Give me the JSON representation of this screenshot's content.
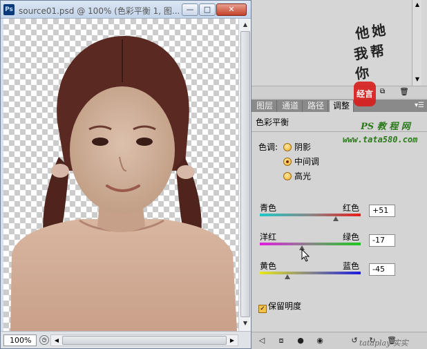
{
  "document": {
    "title": "source01.psd @ 100% (色彩平衡 1, 图...",
    "app_icon": "Ps",
    "zoom": "100%",
    "controls": {
      "minimize": "—",
      "maximize": "□",
      "close": "✕"
    }
  },
  "panel_tabs": [
    {
      "label": "图层",
      "active": false
    },
    {
      "label": "通道",
      "active": false
    },
    {
      "label": "路径",
      "active": false
    },
    {
      "label": "调整",
      "active": true
    }
  ],
  "adjustments": {
    "title": "色彩平衡",
    "tone_label": "色调:",
    "tones": [
      {
        "label": "阴影",
        "checked": false
      },
      {
        "label": "中间调",
        "checked": true
      },
      {
        "label": "高光",
        "checked": false
      }
    ],
    "sliders": [
      {
        "left": "青色",
        "right": "红色",
        "value": "+51",
        "level": 51,
        "colors": [
          "#1ec8c8",
          "#e81c1c"
        ]
      },
      {
        "left": "洋红",
        "right": "绿色",
        "value": "-17",
        "level": -17,
        "colors": [
          "#e01ce0",
          "#1cc81c"
        ]
      },
      {
        "left": "黄色",
        "right": "蓝色",
        "value": "-45",
        "level": -45,
        "colors": [
          "#e8e81c",
          "#1c1ce0"
        ]
      }
    ],
    "preserve_luminosity": "保留明度",
    "preserve_checked": true
  },
  "watermarks": {
    "calligraphy": [
      "他",
      "她",
      "我",
      "帮",
      "你"
    ],
    "seal": "经言",
    "ps_tutorial": "PS 教 程 网",
    "url": "www.tata580.com",
    "footer": "tataplay 实实"
  },
  "colors": {
    "skin_sepia": "#c9a58c",
    "hair": "#5a2a22",
    "panel_bg": "#d4d4d4",
    "tab_bar": "#8a8a8a"
  }
}
